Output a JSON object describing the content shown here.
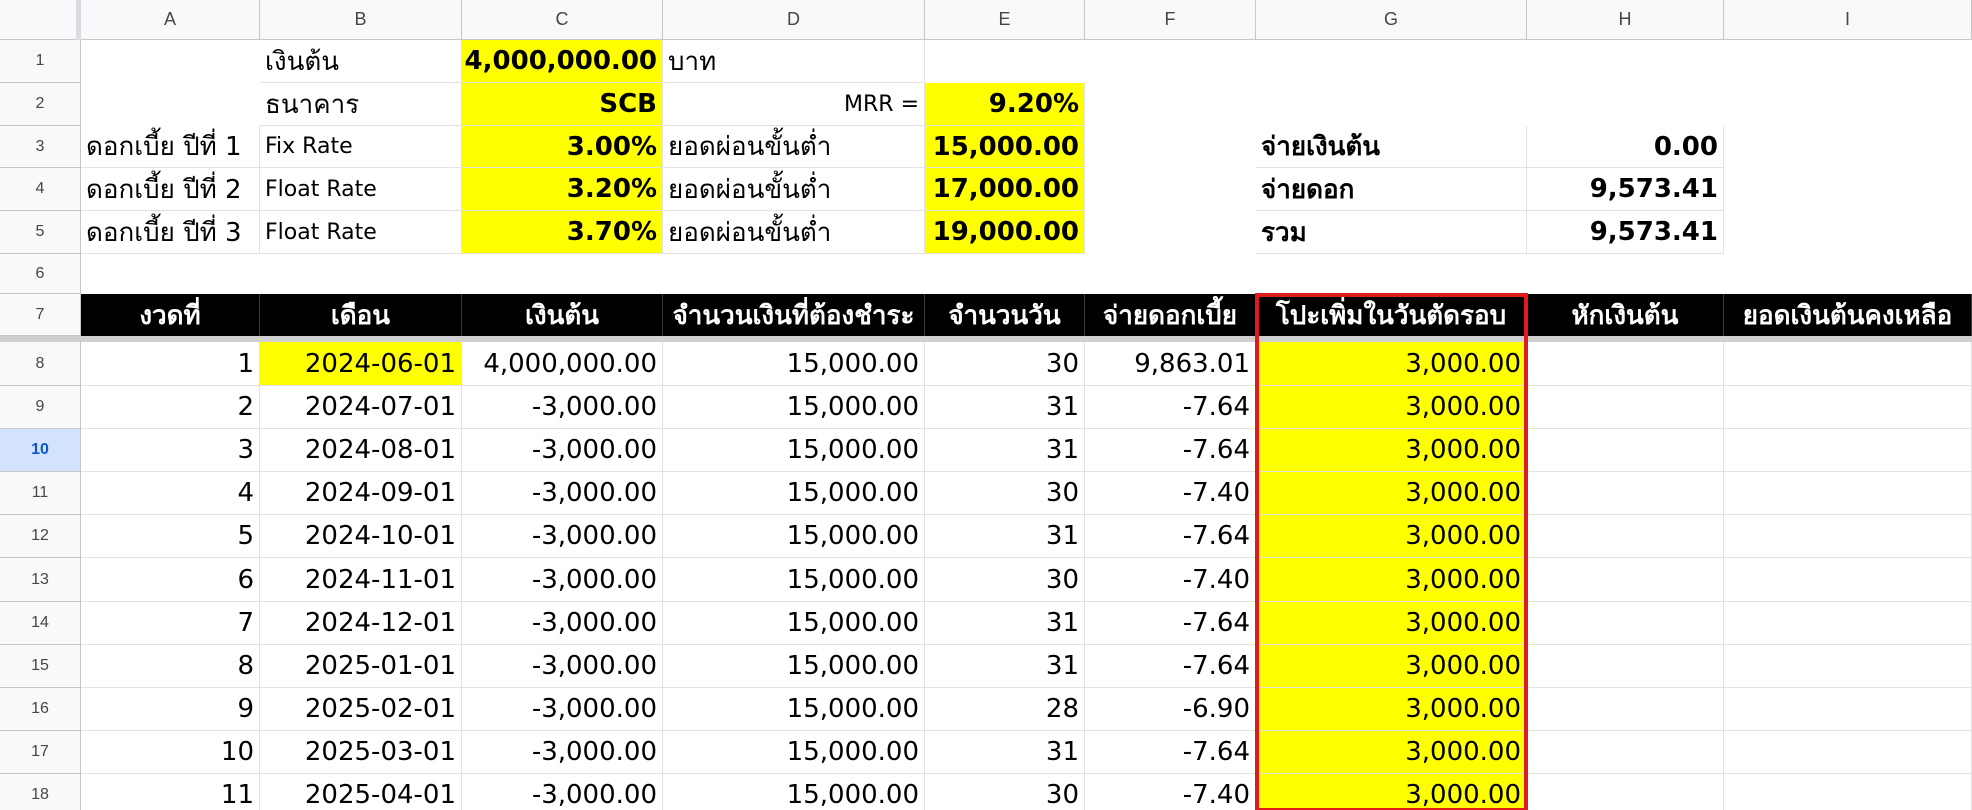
{
  "columns": [
    "A",
    "B",
    "C",
    "D",
    "E",
    "F",
    "G",
    "H",
    "I"
  ],
  "row_numbers": [
    "1",
    "2",
    "3",
    "4",
    "5",
    "6",
    "7",
    "8",
    "9",
    "10",
    "11",
    "12",
    "13",
    "14",
    "15",
    "16",
    "17",
    "18"
  ],
  "selected_row": "10",
  "summary": {
    "principal_label": "เงินต้น",
    "principal_value": "4,000,000.00",
    "currency": "บาท",
    "bank_label": "ธนาคาร",
    "bank_value": "SCB",
    "mrr_label": "MRR =",
    "mrr_value": "9.20%",
    "years": [
      {
        "label": "ดอกเบี้ย ปีที่ 1",
        "type": "Fix Rate",
        "rate": "3.00%",
        "min_label": "ยอดผ่อนขั้นต่ำ",
        "min_value": "15,000.00"
      },
      {
        "label": "ดอกเบี้ย ปีที่ 2",
        "type": "Float Rate",
        "rate": "3.20%",
        "min_label": "ยอดผ่อนขั้นต่ำ",
        "min_value": "17,000.00"
      },
      {
        "label": "ดอกเบี้ย ปีที่ 3",
        "type": "Float Rate",
        "rate": "3.70%",
        "min_label": "ยอดผ่อนขั้นต่ำ",
        "min_value": "19,000.00"
      }
    ],
    "totals": [
      {
        "label": "จ่ายเงินต้น",
        "value": "0.00"
      },
      {
        "label": "จ่ายดอก",
        "value": "9,573.41"
      },
      {
        "label": "รวม",
        "value": "9,573.41"
      }
    ]
  },
  "table": {
    "headers": [
      "งวดที่",
      "เดือน",
      "เงินต้น",
      "จำนวนเงินที่ต้องชำระ",
      "จำนวนวัน",
      "จ่ายดอกเบี้ย",
      "โปะเพิ่มในวันตัดรอบ",
      "หักเงินต้น",
      "ยอดเงินต้นคงเหลือ"
    ],
    "rows": [
      [
        "1",
        "2024-06-01",
        "4,000,000.00",
        "15,000.00",
        "30",
        "9,863.01",
        "3,000.00"
      ],
      [
        "2",
        "2024-07-01",
        "-3,000.00",
        "15,000.00",
        "31",
        "-7.64",
        "3,000.00"
      ],
      [
        "3",
        "2024-08-01",
        "-3,000.00",
        "15,000.00",
        "31",
        "-7.64",
        "3,000.00"
      ],
      [
        "4",
        "2024-09-01",
        "-3,000.00",
        "15,000.00",
        "30",
        "-7.40",
        "3,000.00"
      ],
      [
        "5",
        "2024-10-01",
        "-3,000.00",
        "15,000.00",
        "31",
        "-7.64",
        "3,000.00"
      ],
      [
        "6",
        "2024-11-01",
        "-3,000.00",
        "15,000.00",
        "30",
        "-7.40",
        "3,000.00"
      ],
      [
        "7",
        "2024-12-01",
        "-3,000.00",
        "15,000.00",
        "31",
        "-7.64",
        "3,000.00"
      ],
      [
        "8",
        "2025-01-01",
        "-3,000.00",
        "15,000.00",
        "31",
        "-7.64",
        "3,000.00"
      ],
      [
        "9",
        "2025-02-01",
        "-3,000.00",
        "15,000.00",
        "28",
        "-6.90",
        "3,000.00"
      ],
      [
        "10",
        "2025-03-01",
        "-3,000.00",
        "15,000.00",
        "31",
        "-7.64",
        "3,000.00"
      ],
      [
        "11",
        "2025-04-01",
        "-3,000.00",
        "15,000.00",
        "30",
        "-7.40",
        "3,000.00"
      ]
    ]
  },
  "colors": {
    "highlight": "#ffff00",
    "header_bg": "#000000",
    "header_text": "#ffffff",
    "outline": "#e01b1b",
    "selected_row_bg": "#d3e3fd"
  }
}
